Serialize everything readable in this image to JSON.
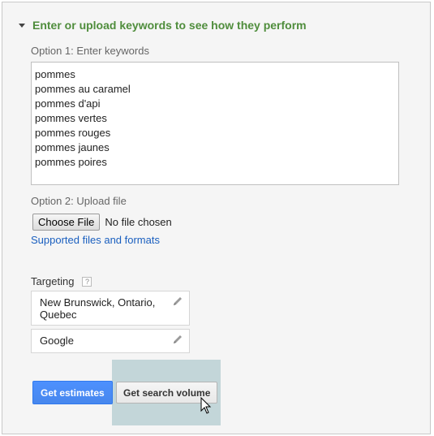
{
  "section": {
    "title": "Enter or upload keywords to see how they perform"
  },
  "option1": {
    "label": "Option 1: Enter keywords",
    "keywords": [
      "pommes",
      "pommes au caramel",
      "pommes d'api",
      "pommes vertes",
      "pommes rouges",
      "pommes jaunes",
      "pommes poires"
    ]
  },
  "option2": {
    "label": "Option 2: Upload file",
    "choose_file_label": "Choose File",
    "no_file_text": "No file chosen",
    "supported_link": "Supported files and formats"
  },
  "targeting": {
    "label": "Targeting",
    "help": "?",
    "locations": "New Brunswick, Ontario, Quebec",
    "network": "Google"
  },
  "actions": {
    "get_estimates": "Get estimates",
    "get_search_volume": "Get search volume"
  },
  "colors": {
    "title_green": "#4f8d3c",
    "link_blue": "#1a5fbf",
    "primary_blue": "#4d90fe",
    "highlight": "#c3d6d9"
  },
  "icons": {
    "collapse": "triangle-down-icon",
    "edit": "pencil-icon",
    "help": "question-mark-icon",
    "pointer": "mouse-cursor-icon"
  }
}
